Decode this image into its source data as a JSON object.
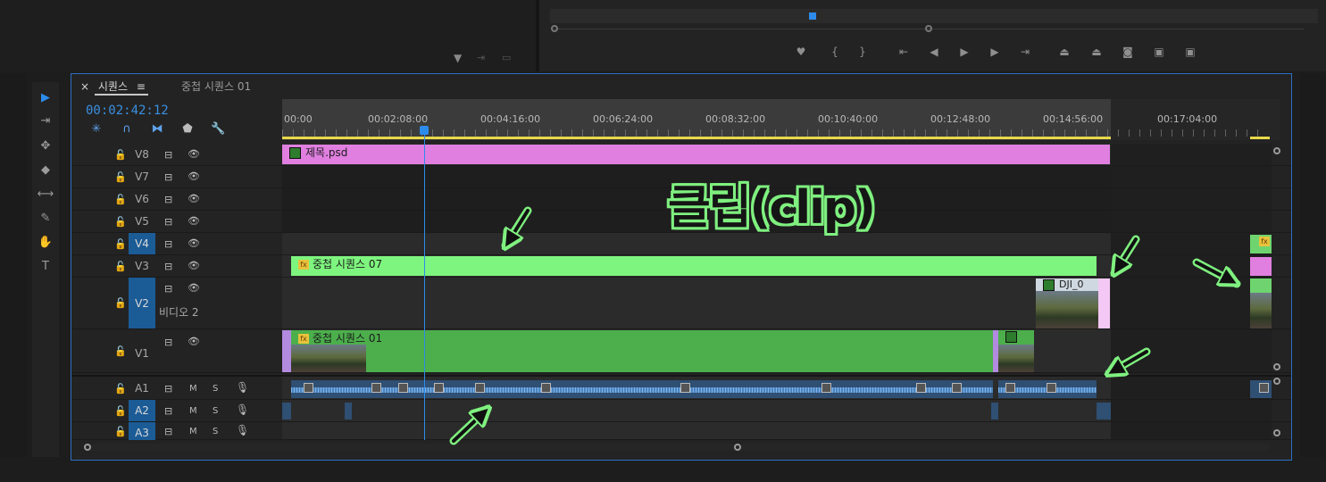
{
  "sequence_panel": {
    "tab_close": "×",
    "tab_active_label": "시퀀스",
    "tab_menu": "≡",
    "tab_second_label": "중첩 시퀀스 01",
    "timecode": "00:02:42:12"
  },
  "ruler": {
    "ticks": [
      "00:00",
      "00:02:08:00",
      "00:04:16:00",
      "00:06:24:00",
      "00:08:32:00",
      "00:10:40:00",
      "00:12:48:00",
      "00:14:56:00",
      "00:17:04:00"
    ]
  },
  "tracks": {
    "video": [
      {
        "name": "V8"
      },
      {
        "name": "V7"
      },
      {
        "name": "V6"
      },
      {
        "name": "V5"
      },
      {
        "name": "V4"
      },
      {
        "name": "V3"
      },
      {
        "name": "V2",
        "label": "비디오 2"
      },
      {
        "name": "V1"
      }
    ],
    "audio": [
      {
        "name": "A1",
        "m": "M",
        "s": "S"
      },
      {
        "name": "A2",
        "m": "M",
        "s": "S"
      },
      {
        "name": "A3",
        "m": "M",
        "s": "S"
      }
    ]
  },
  "clips": {
    "title_psd": "제목.psd",
    "nested_07": "중첩 시퀀스 07",
    "nested_01": "중첩 시퀀스 01",
    "dji": "DJI_0"
  },
  "fx_badge": "fx",
  "annotation": "클립(clip)",
  "colors": {
    "pink_clip": "#e07fe0",
    "green_clip": "#7ef57e",
    "dark_green_clip": "#4caf4c",
    "accent_blue": "#2d8ceb",
    "annotation_green": "#7ff07f"
  }
}
